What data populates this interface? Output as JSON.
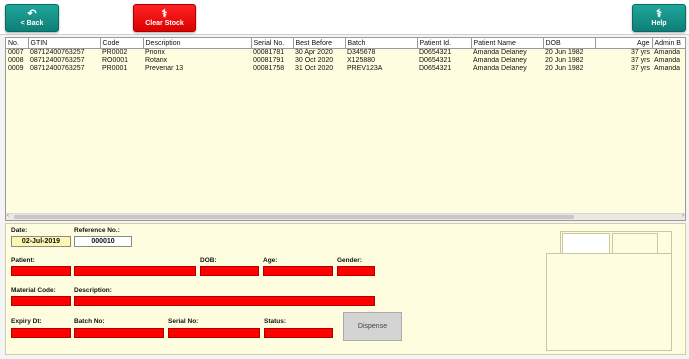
{
  "toolbar": {
    "back_label": "< Back",
    "clear_label": "Clear Stock",
    "help_label": "Help"
  },
  "colors": {
    "teal": "#13938a",
    "red": "#ff0000",
    "grid_bg": "#fffde0"
  },
  "grid": {
    "columns": [
      "No.",
      "GTIN",
      "Code",
      "Description",
      "Serial No.",
      "Best Before",
      "Batch",
      "Patient Id.",
      "Patient Name",
      "DOB",
      "Age",
      "Admin B"
    ],
    "rows": [
      [
        "0007",
        "08712400763257",
        "PR0002",
        "Priorix",
        "00081781",
        "30 Apr 2020",
        "D345678",
        "D0654321",
        "Amanda Delaney",
        "20 Jun 1982",
        "37 yrs",
        "Amanda"
      ],
      [
        "0008",
        "08712400763257",
        "RO0001",
        "Rotarix",
        "00081791",
        "30 Oct 2020",
        "X125880",
        "D0654321",
        "Amanda Delaney",
        "20 Jun 1982",
        "37 yrs",
        "Amanda"
      ],
      [
        "0009",
        "08712400763257",
        "PR0001",
        "Prevenar 13",
        "00081758",
        "31 Oct 2020",
        "PREV123A",
        "D0654321",
        "Amanda Delaney",
        "20 Jun 1982",
        "37 yrs",
        "Amanda"
      ]
    ]
  },
  "form": {
    "date_label": "Date:",
    "date_value": "02-Jul-2019",
    "reference_label": "Reference No.:",
    "reference_value": "000010",
    "patient_label": "Patient:",
    "dob_label": "DOB:",
    "age_label": "Age:",
    "gender_label": "Gender:",
    "material_label": "Material Code:",
    "description_label": "Description:",
    "expiry_label": "Expiry Dt:",
    "batch_label": "Batch No:",
    "serial_label": "Serial No:",
    "status_label": "Status:",
    "dispense_label": "Dispense"
  }
}
